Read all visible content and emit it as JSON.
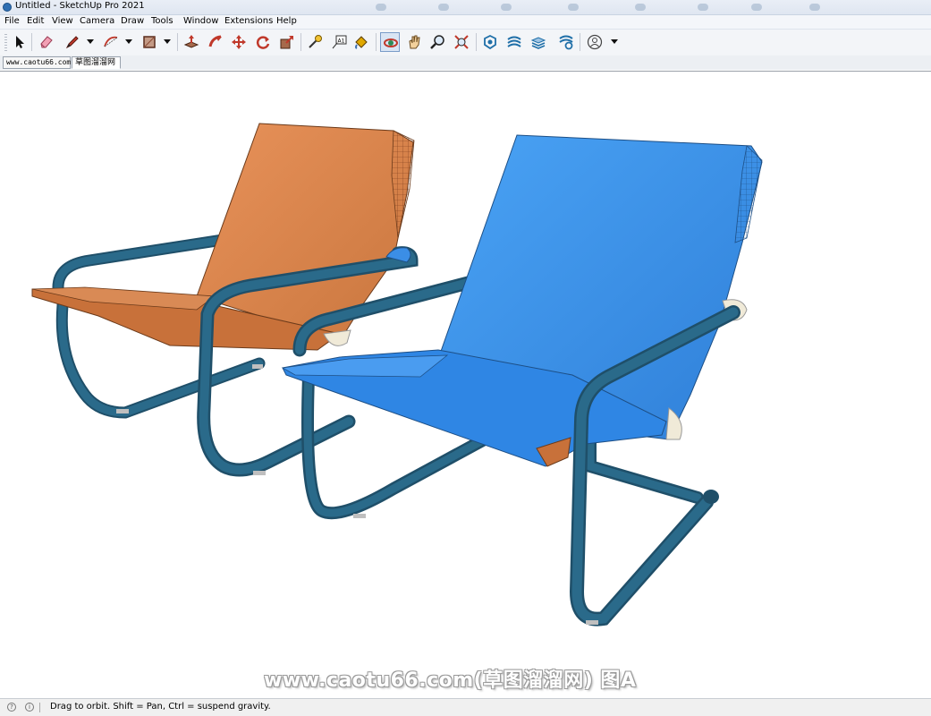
{
  "window": {
    "title": "Untitled - SketchUp Pro 2021"
  },
  "menu": [
    "File",
    "Edit",
    "View",
    "Camera",
    "Draw",
    "Tools",
    "Window",
    "Extensions",
    "Help"
  ],
  "toolbar": {
    "tools": [
      {
        "icon": "select-icon"
      },
      {
        "icon": "eraser-icon"
      },
      {
        "icon": "pencil-line-icon"
      },
      {
        "icon": "arc-icon"
      },
      {
        "icon": "rectangle-icon"
      },
      {
        "icon": "push-pull-icon"
      },
      {
        "icon": "follow-me-icon"
      },
      {
        "icon": "move-icon"
      },
      {
        "icon": "rotate-icon"
      },
      {
        "icon": "scale-icon"
      },
      {
        "icon": "tape-measure-icon"
      },
      {
        "icon": "text-icon"
      },
      {
        "icon": "paint-bucket-icon"
      },
      {
        "icon": "orbit-icon",
        "active": true
      },
      {
        "icon": "pan-icon"
      },
      {
        "icon": "zoom-icon"
      },
      {
        "icon": "zoom-extents-icon"
      },
      {
        "icon": "warehouse-icon"
      },
      {
        "icon": "extension-warehouse-icon"
      },
      {
        "icon": "layout-icon"
      },
      {
        "icon": "extension-manager-icon"
      },
      {
        "icon": "account-icon"
      }
    ],
    "text_tool_label": "A1"
  },
  "scene_tabs": [
    "www.caotu66.com",
    "草图溜溜网"
  ],
  "viewport": {
    "watermark": "www.caotu66.com(草图溜溜网) 图A",
    "colors": {
      "seat_left": "#d9854a",
      "seat_right": "#3b8ee6",
      "frame": "#1f5a78",
      "background": "#ffffff"
    }
  },
  "statusbar": {
    "message": "Drag to orbit. Shift = Pan, Ctrl = suspend gravity."
  }
}
